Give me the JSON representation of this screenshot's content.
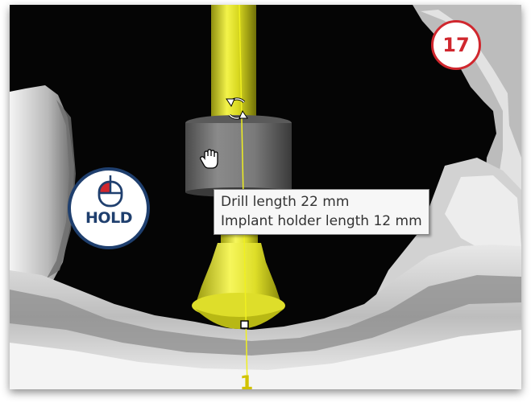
{
  "tooltip": {
    "drill_length": "Drill length 22 mm",
    "holder_length": "Implant holder length 12 mm"
  },
  "step_badge": {
    "number": "17",
    "color": "#d0272e"
  },
  "hold_badge": {
    "label": "HOLD",
    "color": "#1f3f6e",
    "accent": "#d0272e"
  },
  "implant": {
    "number": "1",
    "color": "#e6e600"
  },
  "icons": {
    "rotate": "rotate-icon",
    "hand_cursor": "hand-cursor-icon",
    "mouse_left_button": "mouse-left-button-icon"
  }
}
